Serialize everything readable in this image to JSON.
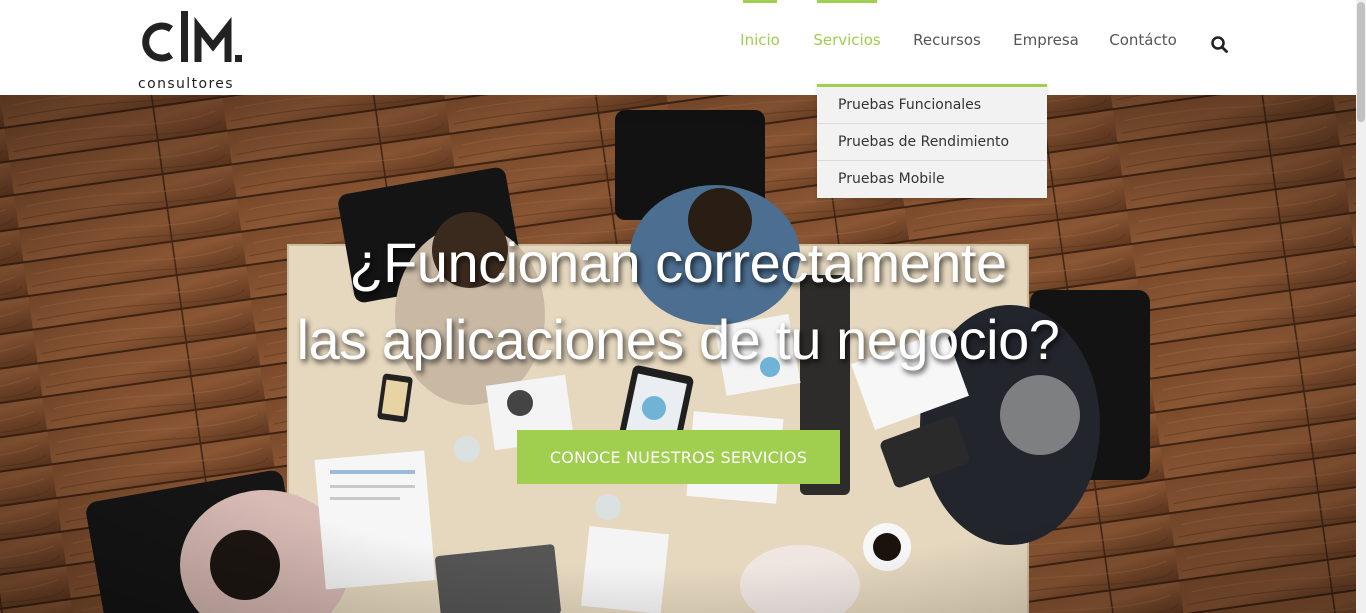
{
  "logo": {
    "sub": "consultores",
    "icon": "clm-logo-icon"
  },
  "nav": {
    "items": [
      {
        "label": "Inicio",
        "active": true
      },
      {
        "label": "Servicios",
        "active": true
      },
      {
        "label": "Recursos",
        "active": false
      },
      {
        "label": "Empresa",
        "active": false
      },
      {
        "label": "Contácto",
        "active": false
      }
    ],
    "search_icon": "search-icon"
  },
  "dropdown": {
    "items": [
      "Pruebas Funcionales",
      "Pruebas de Rendimiento",
      "Pruebas Mobile"
    ]
  },
  "hero": {
    "title_line1": "¿Funcionan correctamente",
    "title_line2": "las aplicaciones de tu negocio?",
    "cta": "CONOCE NUESTROS SERVICIOS"
  },
  "colors": {
    "accent": "#a0ce4e",
    "text": "#555555",
    "dropdown_bg": "#f2f2f2"
  }
}
